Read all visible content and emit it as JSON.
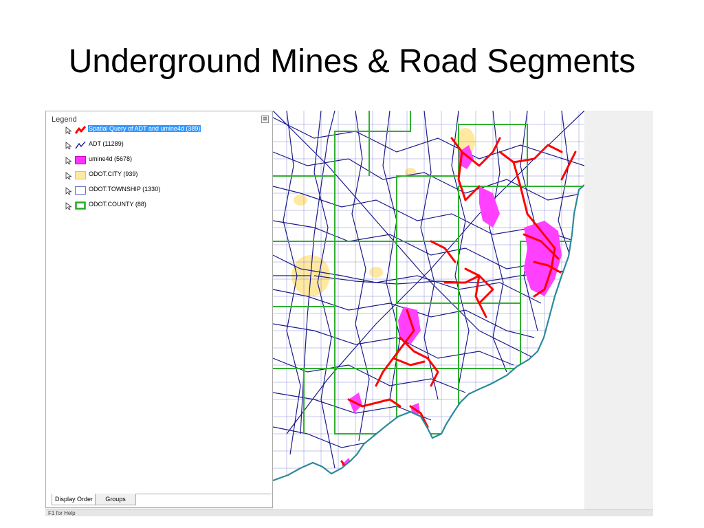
{
  "slide": {
    "title": "Underground Mines & Road Segments"
  },
  "legend": {
    "title": "Legend",
    "close_glyph": "⊠",
    "layers": [
      {
        "label": "Spatial Query of ADT and umine4d (389)",
        "icon": "red-line-icon",
        "selected": true,
        "color": "#ff0000"
      },
      {
        "label": "ADT (11289)",
        "icon": "blue-line-icon",
        "selected": false,
        "color": "#00008b"
      },
      {
        "label": "umine4d (5678)",
        "icon": "magenta-fill-icon",
        "selected": false,
        "color": "#ff33ff"
      },
      {
        "label": "ODOT.CITY (939)",
        "icon": "yellow-fill-icon",
        "selected": false,
        "color": "#ffe9a0"
      },
      {
        "label": "ODOT.TOWNSHIP (1330)",
        "icon": "outline-box-icon",
        "selected": false,
        "color": "#6a6acc"
      },
      {
        "label": "ODOT.COUNTY (88)",
        "icon": "green-outline-icon",
        "selected": false,
        "color": "#22aa22"
      }
    ],
    "tabs": [
      {
        "label": "Display Order",
        "active": true
      },
      {
        "label": "Groups",
        "active": false
      }
    ]
  },
  "status": {
    "text": "F1 for Help"
  },
  "colors": {
    "roads": "#1a1a8c",
    "county": "#2fb02f",
    "mines": "#ff40ff",
    "query": "#ff0000",
    "city": "#ffe9a0",
    "river": "#2a8a9a"
  }
}
